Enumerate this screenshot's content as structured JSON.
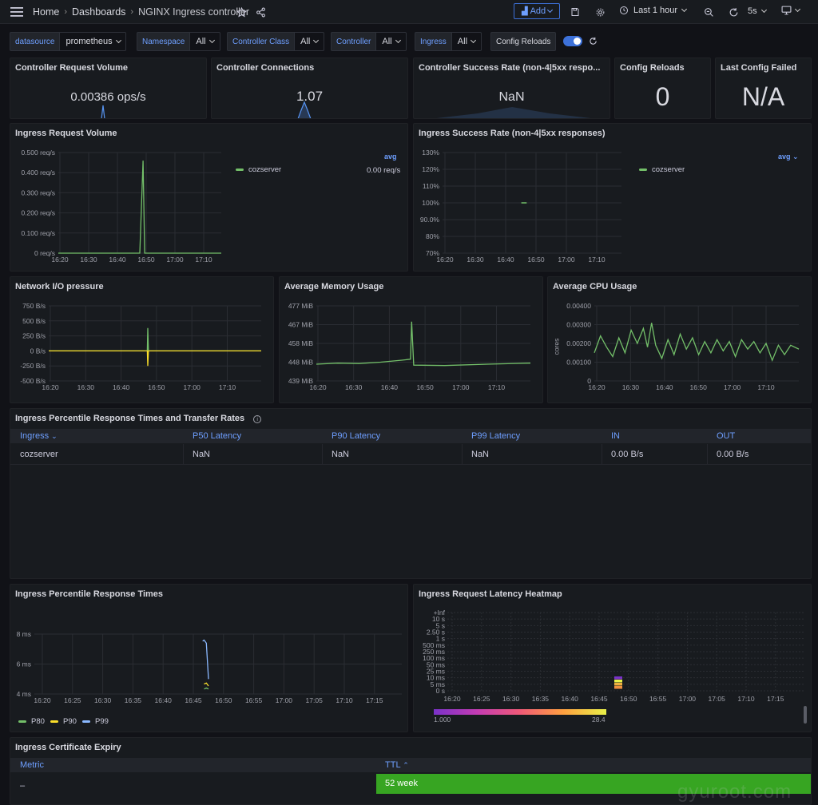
{
  "breadcrumb": {
    "home": "Home",
    "dashboards": "Dashboards",
    "current": "NGINX Ingress controller"
  },
  "toolbar": {
    "add_label": "Add",
    "time_range": "Last 1 hour",
    "refresh_interval": "5s"
  },
  "variables": [
    {
      "label": "datasource",
      "value": "prometheus"
    },
    {
      "label": "Namespace",
      "value": "All"
    },
    {
      "label": "Controller Class",
      "value": "All"
    },
    {
      "label": "Controller",
      "value": "All"
    },
    {
      "label": "Ingress",
      "value": "All"
    }
  ],
  "config_reloads_toggle": {
    "label": "Config Reloads",
    "on": true
  },
  "stats": {
    "request_volume": {
      "title": "Controller Request Volume",
      "value": "0.00386 ops/s"
    },
    "connections": {
      "title": "Controller Connections",
      "value": "1.07"
    },
    "success_rate": {
      "title": "Controller Success Rate (non-4|5xx respo...",
      "value": "NaN"
    },
    "config_reloads": {
      "title": "Config Reloads",
      "value": "0"
    },
    "last_config_failed": {
      "title": "Last Config Failed",
      "value": "N/A"
    }
  },
  "panels": {
    "ingress_request_volume": {
      "title": "Ingress Request Volume",
      "legend_mode": "avg",
      "legend_series": "cozserver",
      "legend_value": "0.00 req/s"
    },
    "ingress_success_rate": {
      "title": "Ingress Success Rate (non-4|5xx responses)",
      "legend_mode": "avg",
      "legend_series": "cozserver"
    },
    "network_io": {
      "title": "Network I/O pressure"
    },
    "memory": {
      "title": "Average Memory Usage"
    },
    "cpu": {
      "title": "Average CPU Usage",
      "ylabel": "cores"
    },
    "percentile_table": {
      "title": "Ingress Percentile Response Times and Transfer Rates"
    },
    "percentile_times": {
      "title": "Ingress Percentile Response Times"
    },
    "heatmap": {
      "title": "Ingress Request Latency Heatmap",
      "scale_min": "1.000",
      "scale_max": "28.4"
    },
    "cert_expiry": {
      "title": "Ingress Certificate Expiry"
    }
  },
  "percentile_table": {
    "headers": [
      "Ingress",
      "P50 Latency",
      "P90 Latency",
      "P99 Latency",
      "IN",
      "OUT"
    ],
    "rows": [
      [
        "cozserver",
        "NaN",
        "NaN",
        "NaN",
        "0.00 B/s",
        "0.00 B/s"
      ]
    ]
  },
  "cert_table": {
    "headers": [
      "Metric",
      "TTL"
    ],
    "rows": [
      [
        "–",
        "52 week"
      ]
    ]
  },
  "watermark": "gyuroot.com",
  "colors": {
    "green": "#73bf69",
    "yellow": "#fade2a",
    "blue": "#8ab8ff",
    "accent": "#6e9fff",
    "ttl_bg": "#37a522"
  },
  "chart_data": [
    {
      "type": "line",
      "title": "Ingress Request Volume",
      "x": [
        "16:20",
        "16:30",
        "16:40",
        "16:50",
        "17:00",
        "17:10"
      ],
      "yticks": [
        "0.500 req/s",
        "0.400 req/s",
        "0.300 req/s",
        "0.200 req/s",
        "0.100 req/s",
        "0 req/s"
      ],
      "ylim": [
        0,
        0.5
      ],
      "series": [
        {
          "name": "cozserver",
          "points": [
            [
              0,
              0
            ],
            [
              0.5,
              0
            ],
            [
              0.52,
              0.46
            ],
            [
              0.53,
              0
            ],
            [
              1,
              0
            ]
          ]
        }
      ]
    },
    {
      "type": "line",
      "title": "Ingress Success Rate (non-4|5xx responses)",
      "x": [
        "16:20",
        "16:30",
        "16:40",
        "16:50",
        "17:00",
        "17:10"
      ],
      "yticks": [
        "130%",
        "120%",
        "110%",
        "100%",
        "90.0%",
        "80%",
        "70%"
      ],
      "ylim": [
        70,
        130
      ],
      "series": [
        {
          "name": "cozserver",
          "points": [
            [
              0.44,
              100
            ],
            [
              0.47,
              100
            ]
          ]
        }
      ]
    },
    {
      "type": "line",
      "title": "Network I/O pressure",
      "x": [
        "16:20",
        "16:30",
        "16:40",
        "16:50",
        "17:00",
        "17:10"
      ],
      "yticks": [
        "750 B/s",
        "500 B/s",
        "250 B/s",
        "0 B/s",
        "-250 B/s",
        "-500 B/s"
      ],
      "ylim": [
        -500,
        750
      ],
      "series": [
        {
          "points": [
            [
              0,
              0
            ],
            [
              0.464,
              0
            ],
            [
              0.466,
              380
            ],
            [
              0.469,
              0
            ],
            [
              1,
              0
            ]
          ]
        },
        {
          "points": [
            [
              0,
              0
            ],
            [
              0.464,
              0
            ],
            [
              0.466,
              -250
            ],
            [
              0.469,
              0
            ],
            [
              1,
              0
            ]
          ]
        }
      ]
    },
    {
      "type": "line",
      "title": "Average Memory Usage",
      "x": [
        "16:20",
        "16:30",
        "16:40",
        "16:50",
        "17:00",
        "17:10"
      ],
      "yticks": [
        "477 MiB",
        "467 MiB",
        "458 MiB",
        "448 MiB",
        "439 MiB"
      ],
      "ylim": [
        439,
        477
      ],
      "series": [
        {
          "points": [
            [
              0,
              447.5
            ],
            [
              0.1,
              448
            ],
            [
              0.2,
              447.8
            ],
            [
              0.3,
              448.5
            ],
            [
              0.4,
              449.5
            ],
            [
              0.44,
              450
            ],
            [
              0.445,
              469
            ],
            [
              0.455,
              447
            ],
            [
              0.6,
              446.8
            ],
            [
              0.8,
              447.5
            ],
            [
              1,
              448
            ]
          ]
        }
      ]
    },
    {
      "type": "line",
      "title": "Average CPU Usage",
      "x": [
        "16:20",
        "16:30",
        "16:40",
        "16:50",
        "17:00",
        "17:10"
      ],
      "yticks": [
        "0.00400",
        "0.00300",
        "0.00200",
        "0.00100",
        "0"
      ],
      "ylim": [
        0,
        0.004
      ],
      "ylabel": "cores",
      "series": [
        {
          "points": [
            [
              0,
              0.0015
            ],
            [
              0.03,
              0.0024
            ],
            [
              0.06,
              0.0018
            ],
            [
              0.09,
              0.0013
            ],
            [
              0.12,
              0.0023
            ],
            [
              0.15,
              0.0015
            ],
            [
              0.18,
              0.0027
            ],
            [
              0.21,
              0.002
            ],
            [
              0.24,
              0.0028
            ],
            [
              0.26,
              0.0018
            ],
            [
              0.28,
              0.0031
            ],
            [
              0.3,
              0.0019
            ],
            [
              0.33,
              0.0012
            ],
            [
              0.36,
              0.0022
            ],
            [
              0.39,
              0.0014
            ],
            [
              0.42,
              0.0025
            ],
            [
              0.45,
              0.0017
            ],
            [
              0.48,
              0.0023
            ],
            [
              0.51,
              0.0014
            ],
            [
              0.54,
              0.0021
            ],
            [
              0.57,
              0.0015
            ],
            [
              0.6,
              0.0022
            ],
            [
              0.63,
              0.0016
            ],
            [
              0.66,
              0.0021
            ],
            [
              0.69,
              0.0013
            ],
            [
              0.72,
              0.0022
            ],
            [
              0.75,
              0.0017
            ],
            [
              0.78,
              0.0021
            ],
            [
              0.81,
              0.0015
            ],
            [
              0.84,
              0.002
            ],
            [
              0.87,
              0.0011
            ],
            [
              0.9,
              0.0019
            ],
            [
              0.93,
              0.0014
            ],
            [
              0.96,
              0.0019
            ],
            [
              1,
              0.0017
            ]
          ]
        }
      ]
    },
    {
      "type": "line",
      "title": "Ingress Percentile Response Times",
      "x": [
        "16:20",
        "16:25",
        "16:30",
        "16:35",
        "16:40",
        "16:45",
        "16:50",
        "16:55",
        "17:00",
        "17:05",
        "17:10",
        "17:15"
      ],
      "yticks": [
        "8 ms",
        "6 ms",
        "4 ms"
      ],
      "ylim": [
        3.5,
        9.5
      ],
      "series": [
        {
          "name": "P80",
          "points": [
            [
              0.462,
              4.0
            ],
            [
              0.468,
              4.1
            ],
            [
              0.474,
              4.0
            ]
          ]
        },
        {
          "name": "P90",
          "points": [
            [
              0.462,
              4.5
            ],
            [
              0.468,
              4.6
            ],
            [
              0.474,
              4.3
            ]
          ]
        },
        {
          "name": "P99",
          "points": [
            [
              0.458,
              8.8
            ],
            [
              0.462,
              8.9
            ],
            [
              0.468,
              8.6
            ],
            [
              0.474,
              5.0
            ]
          ]
        }
      ]
    },
    {
      "type": "heatmap",
      "title": "Ingress Request Latency Heatmap",
      "x": [
        "16:20",
        "16:25",
        "16:30",
        "16:35",
        "16:40",
        "16:45",
        "16:50",
        "16:55",
        "17:00",
        "17:05",
        "17:10",
        "17:15"
      ],
      "y": [
        "+Inf",
        "10 s",
        "5 s",
        "2.50 s",
        "1 s",
        "500 ms",
        "250 ms",
        "100 ms",
        "50 ms",
        "25 ms",
        "10 ms",
        "5 ms",
        "0 s"
      ],
      "scale": [
        1.0,
        28.4
      ]
    }
  ]
}
